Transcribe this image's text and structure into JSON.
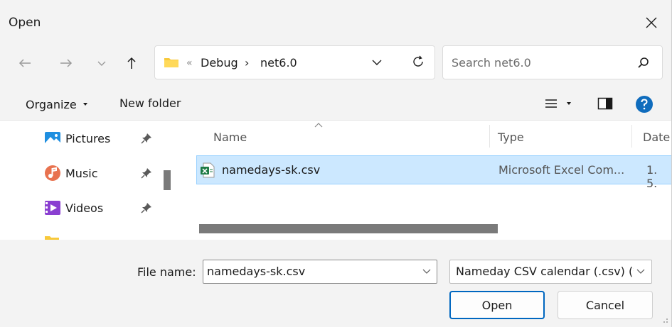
{
  "window": {
    "title": "Open"
  },
  "address_bar": {
    "overflow_glyph": "«",
    "crumbs": [
      "Debug",
      "net6.0"
    ],
    "separator": "›"
  },
  "search": {
    "placeholder": "Search net6.0"
  },
  "command_bar": {
    "organize_label": "Organize",
    "new_folder_label": "New folder"
  },
  "nav_pane": {
    "items": [
      {
        "label": "Pictures",
        "icon": "pictures-icon"
      },
      {
        "label": "Music",
        "icon": "music-icon"
      },
      {
        "label": "Videos",
        "icon": "videos-icon"
      }
    ]
  },
  "file_list": {
    "columns": [
      "Name",
      "Type",
      "Date"
    ],
    "rows": [
      {
        "name": "namedays-sk.csv",
        "type": "Microsoft Excel Com...",
        "date": "1. 5.",
        "selected": true
      }
    ]
  },
  "bottom": {
    "file_name_label": "File name:",
    "file_name_value": "namedays-sk.csv",
    "filter_value": "Nameday CSV calendar (.csv) (*.",
    "open_label": "Open",
    "cancel_label": "Cancel"
  },
  "colors": {
    "accent": "#0067c0",
    "selection": "#cce8ff",
    "selection_border": "#99d1ff",
    "chrome": "#f3f3f3",
    "help": "#0f6cbd"
  }
}
